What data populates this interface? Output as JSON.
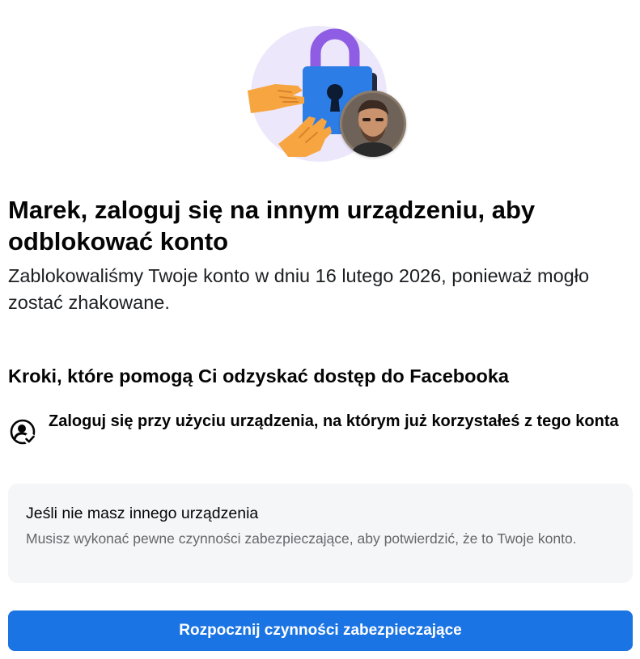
{
  "header": {
    "illustration_icon": "padlock-hands-icon",
    "avatar_alt": "Marek"
  },
  "main": {
    "title": "Marek, zaloguj się na innym urządzeniu, aby odblokować konto",
    "subtitle": "Zablokowaliśmy Twoje konto w dniu 16 lutego 2026, ponieważ mogło zostać zhakowane.",
    "steps_heading": "Kroki, które pomogą Ci odzyskać dostęp do Facebooka",
    "steps": [
      {
        "icon": "user-check-icon",
        "text": "Zaloguj się przy użyciu urządzenia, na którym już korzystałeś z tego konta"
      }
    ],
    "info_box": {
      "title": "Jeśli nie masz innego urządzenia",
      "text": "Musisz wykonać pewne czynności zabezpieczające, aby potwierdzić, że to Twoje konto."
    },
    "button_label": "Rozpocznij czynności zabezpieczające"
  },
  "colors": {
    "accent": "#1b74e4",
    "illustration_circle": "#ede7fb",
    "lock_body": "#2d7de6",
    "lock_shackle": "#8f5de3",
    "hand": "#f7a541",
    "info_box_bg": "#f5f6f8",
    "secondary_text": "#65676b"
  }
}
